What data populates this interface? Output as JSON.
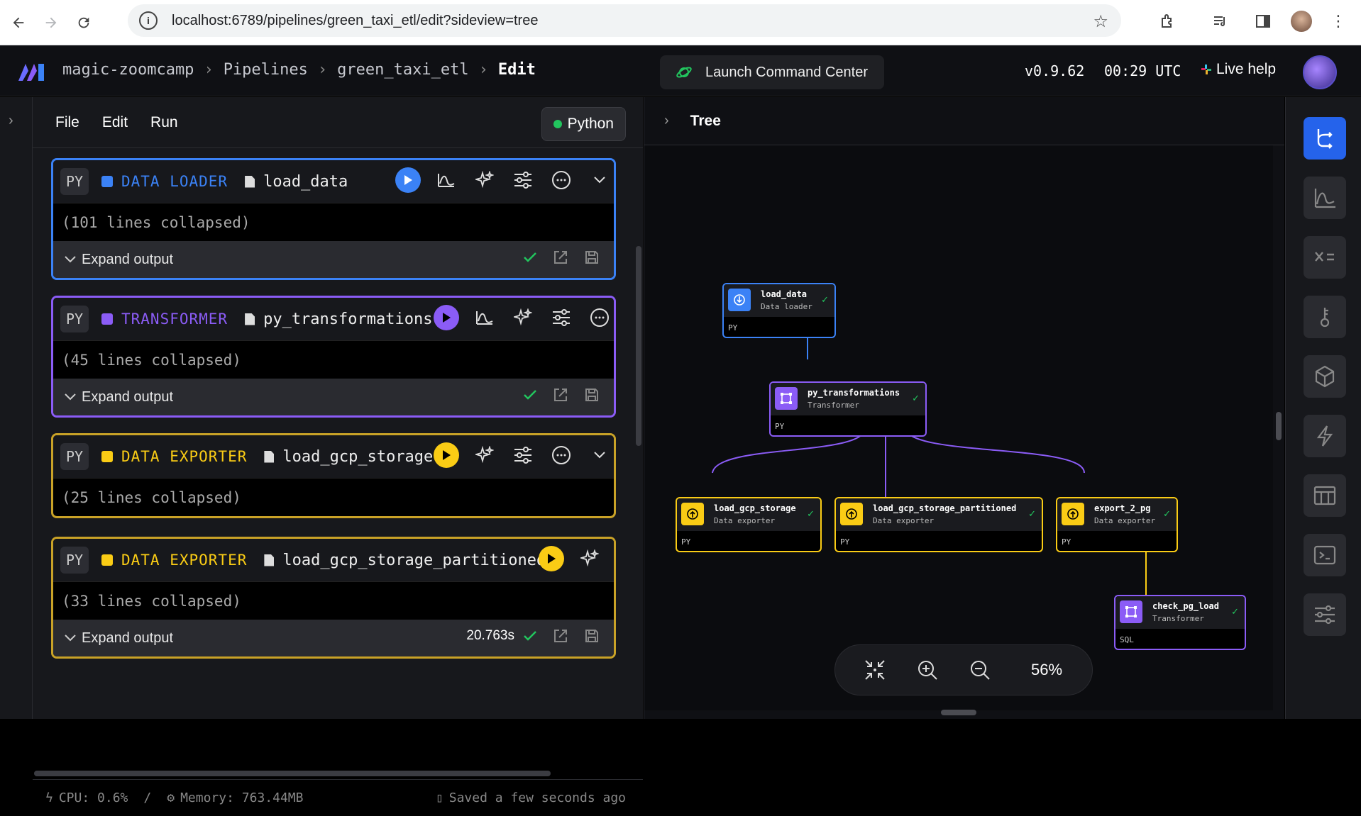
{
  "browser": {
    "url": "localhost:6789/pipelines/green_taxi_etl/edit?sideview=tree"
  },
  "header": {
    "breadcrumbs": [
      "magic-zoomcamp",
      "Pipelines",
      "green_taxi_etl",
      "Edit"
    ],
    "command_center_label": "Launch Command Center",
    "version": "v0.9.62",
    "time": "00:29 UTC",
    "live_help": "Live help"
  },
  "editor": {
    "menu": [
      "File",
      "Edit",
      "Run"
    ],
    "language": "Python",
    "blocks": [
      {
        "tag": "PY",
        "type": "DATA LOADER",
        "name": "load_data",
        "collapsed": "(101 lines collapsed)",
        "expand": "Expand output",
        "time": "",
        "color": "#3b82f6"
      },
      {
        "tag": "PY",
        "type": "TRANSFORMER",
        "name": "py_transformations",
        "collapsed": "(45 lines collapsed)",
        "expand": "Expand output",
        "time": "",
        "color": "#8b5cf6"
      },
      {
        "tag": "PY",
        "type": "DATA EXPORTER",
        "name": "load_gcp_storage",
        "collapsed": "(25 lines collapsed)",
        "expand": "",
        "time": "",
        "color": "#facc15"
      },
      {
        "tag": "PY",
        "type": "DATA EXPORTER",
        "name": "load_gcp_storage_partitioned",
        "collapsed": "(33 lines collapsed)",
        "expand": "Expand output",
        "time": "20.763s",
        "color": "#facc15"
      }
    ],
    "status": {
      "cpu": "CPU: 0.6%",
      "sep": "/",
      "memory": "Memory: 763.44MB",
      "saved": "Saved a few seconds ago"
    }
  },
  "tree": {
    "title": "Tree",
    "zoom": "56%",
    "nodes": [
      {
        "name": "load_data",
        "type": "Data loader",
        "lang": "PY",
        "color": "#3b82f6"
      },
      {
        "name": "py_transformations",
        "type": "Transformer",
        "lang": "PY",
        "color": "#8b5cf6"
      },
      {
        "name": "load_gcp_storage",
        "type": "Data exporter",
        "lang": "PY",
        "color": "#facc15"
      },
      {
        "name": "load_gcp_storage_partitioned",
        "type": "Data exporter",
        "lang": "PY",
        "color": "#facc15"
      },
      {
        "name": "export_2_pg",
        "type": "Data exporter",
        "lang": "PY",
        "color": "#facc15"
      },
      {
        "name": "check_pg_load",
        "type": "Transformer",
        "lang": "SQL",
        "color": "#8b5cf6"
      }
    ]
  },
  "sidebar_icons": [
    "tree-icon",
    "chart-icon",
    "variables-icon",
    "secrets-icon",
    "cube-icon",
    "lightning-icon",
    "table-icon",
    "terminal-icon",
    "settings-sliders-icon"
  ]
}
